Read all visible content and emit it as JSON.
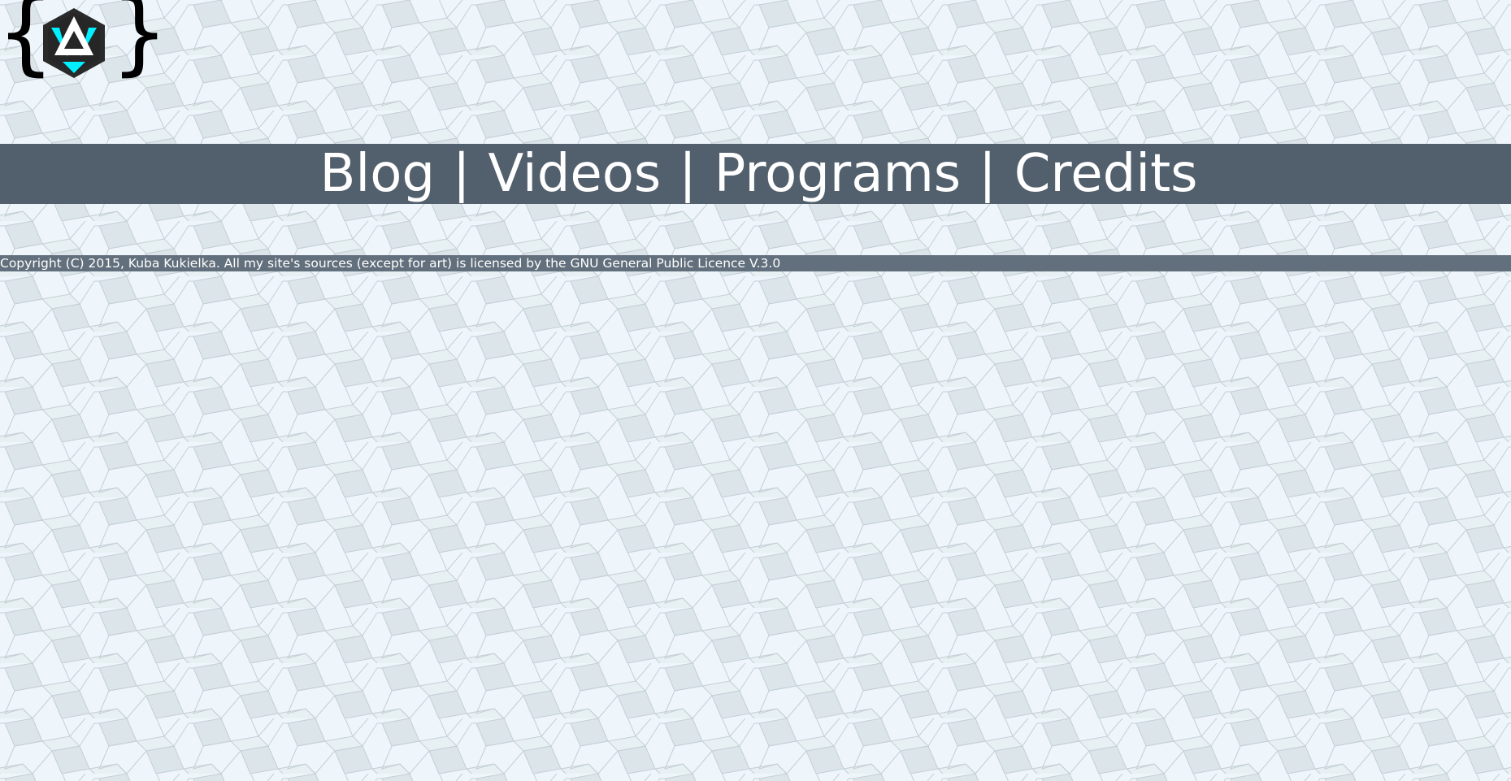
{
  "site": {
    "logo_icon": "site-logo-icon",
    "brace_left": "{",
    "brace_right": "}",
    "emblem_colors": {
      "dark": "#2a2a2a",
      "accent": "#00f0ff",
      "light": "#ffffff"
    }
  },
  "nav": {
    "items": [
      {
        "label": "Blog"
      },
      {
        "label": "Videos"
      },
      {
        "label": "Programs"
      },
      {
        "label": "Credits"
      }
    ],
    "separator": "|",
    "bar_color": "#525f6c"
  },
  "footer": {
    "text": "Copyright (C) 2015, Kuba Kukielka. All my site's sources (except for art) is licensed by the GNU General Public Licence V.3.0",
    "bar_color": "#626f7c"
  },
  "background": {
    "pattern": "rhombus-tiling",
    "colors": [
      "#eef6fb",
      "#dde7ec",
      "#e6eff2",
      "#c4cfd5"
    ]
  }
}
